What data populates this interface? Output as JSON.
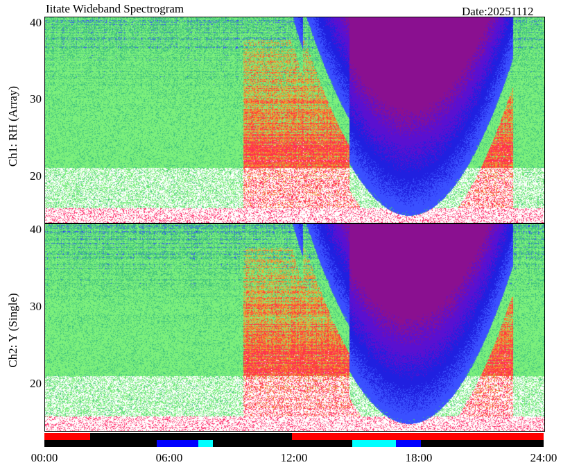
{
  "header": {
    "title": "Iitate Wideband Spectrogram",
    "date": "Date:20251112"
  },
  "chart_data": [
    {
      "type": "heatmap",
      "ylabel": "Ch1: RH (Array)",
      "yticks": [
        "40",
        "30",
        "20"
      ],
      "ytick_values": [
        40,
        30,
        20
      ],
      "ylim": [
        12.5,
        40.5
      ],
      "xlim": [
        0,
        24
      ],
      "xticks": [
        "00:00",
        "06:00",
        "12:00",
        "18:00",
        "24:00"
      ],
      "seed": 11,
      "colors": [
        "#ffffff",
        "#ff2a6a",
        "#ff3a3a",
        "#f0a030",
        "#7cf07c",
        "#40c080",
        "#3a50ff",
        "#2020e0",
        "#5a10d0",
        "#8a1090"
      ]
    },
    {
      "type": "heatmap",
      "ylabel": "Ch2: Y (Single)",
      "yticks": [
        "40",
        "30",
        "20"
      ],
      "ytick_values": [
        40,
        30,
        20
      ],
      "ylim": [
        12.5,
        40.5
      ],
      "xlim": [
        0,
        24
      ],
      "xticks": [
        "00:00",
        "06:00",
        "12:00",
        "18:00",
        "24:00"
      ],
      "seed": 29,
      "colors": [
        "#ffffff",
        "#ff2a6a",
        "#ff3a3a",
        "#f0a030",
        "#7cf07c",
        "#40c080",
        "#3a50ff",
        "#2020e0",
        "#5a10d0",
        "#8a1090"
      ]
    }
  ],
  "status_bar": {
    "segments": [
      {
        "start": 0.0,
        "end": 2.2,
        "row": "top",
        "color": "#ff0000"
      },
      {
        "start": 2.2,
        "end": 11.9,
        "row": "top",
        "color": "#000000"
      },
      {
        "start": 11.9,
        "end": 24.0,
        "row": "top",
        "color": "#ff0000"
      },
      {
        "start": 0.0,
        "end": 5.4,
        "row": "bottom",
        "color": "#000000"
      },
      {
        "start": 5.4,
        "end": 7.4,
        "row": "bottom",
        "color": "#0000ff"
      },
      {
        "start": 7.4,
        "end": 8.1,
        "row": "bottom",
        "color": "#00ffff"
      },
      {
        "start": 8.1,
        "end": 14.8,
        "row": "bottom",
        "color": "#000000"
      },
      {
        "start": 14.8,
        "end": 16.9,
        "row": "bottom",
        "color": "#00ffff"
      },
      {
        "start": 16.9,
        "end": 18.1,
        "row": "bottom",
        "color": "#0000ff"
      },
      {
        "start": 18.1,
        "end": 24.0,
        "row": "bottom",
        "color": "#000000"
      }
    ]
  }
}
